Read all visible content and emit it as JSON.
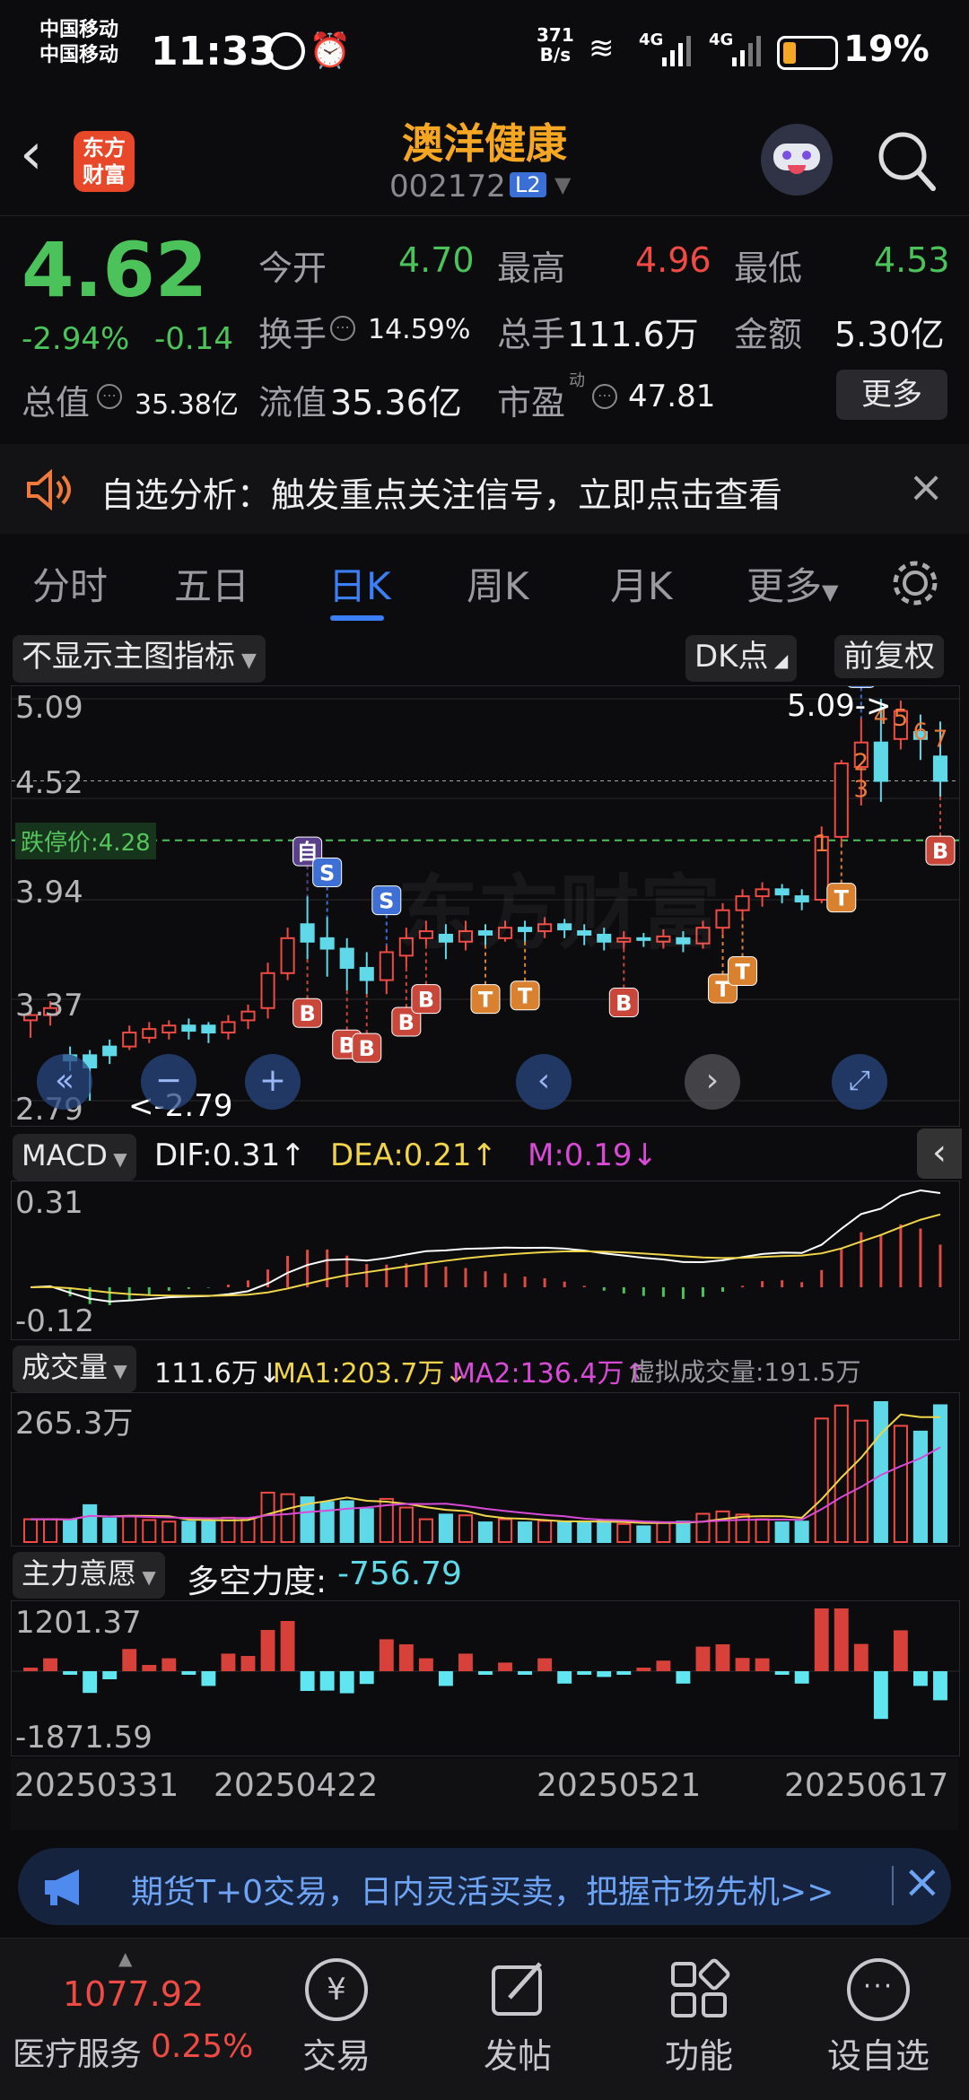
{
  "status": {
    "carrier1": "中国移动",
    "carrier2": "中国移动",
    "time": "11:33",
    "net_speed_top": "371",
    "net_speed_bottom": "B/s",
    "signal1": "4G",
    "signal2": "4G",
    "battery": "19%"
  },
  "header": {
    "logo_line1": "东方",
    "logo_line2": "财富",
    "stock_name": "澳洋健康",
    "stock_code": "002172",
    "level_badge": "L2"
  },
  "quote": {
    "price": "4.62",
    "change_pct": "-2.94%",
    "change": "-0.14",
    "open_label": "今开",
    "open": "4.70",
    "high_label": "最高",
    "high": "4.96",
    "low_label": "最低",
    "low": "4.53",
    "turnover_label": "换手",
    "turnover": "14.59%",
    "volume_label": "总手",
    "volume": "111.6万",
    "amount_label": "金额",
    "amount": "5.30亿",
    "mktcap_label": "总值",
    "mktcap": "35.38亿",
    "float_label": "流值",
    "float": "35.36亿",
    "pe_label": "市盈",
    "pe_sup": "动",
    "pe": "47.81",
    "more_btn": "更多"
  },
  "banner": {
    "text": "自选分析：触发重点关注信号，立即点击查看"
  },
  "tabs": [
    "分时",
    "五日",
    "日K",
    "周K",
    "月K",
    "更多"
  ],
  "active_tab": "日K",
  "chart_controls": {
    "indicator_dropdown": "不显示主图指标",
    "dk_button": "DK点",
    "fq_button": "前复权"
  },
  "chart_data": {
    "type": "candlestick",
    "price_axis": {
      "top": "5.09",
      "upper": "4.52",
      "mid": "3.94",
      "lower": "3.37",
      "bottom": "2.79"
    },
    "limit_down_label": "跌停价:4.28",
    "max_annotation": "5.09->",
    "min_annotation": "<-2.79",
    "dates": [
      "20250331",
      "20250422",
      "20250521",
      "20250617"
    ],
    "watermark": "东方财富",
    "candles": [
      [
        3.25,
        3.28,
        3.15,
        3.3
      ],
      [
        3.28,
        3.32,
        3.22,
        3.36
      ],
      [
        3.05,
        3.02,
        2.96,
        3.1
      ],
      [
        3.05,
        2.98,
        2.79,
        3.08
      ],
      [
        3.1,
        3.05,
        3.0,
        3.14
      ],
      [
        3.1,
        3.18,
        3.08,
        3.22
      ],
      [
        3.15,
        3.2,
        3.12,
        3.24
      ],
      [
        3.18,
        3.22,
        3.14,
        3.25
      ],
      [
        3.22,
        3.19,
        3.14,
        3.26
      ],
      [
        3.22,
        3.18,
        3.12,
        3.24
      ],
      [
        3.18,
        3.24,
        3.14,
        3.28
      ],
      [
        3.25,
        3.3,
        3.2,
        3.34
      ],
      [
        3.32,
        3.52,
        3.26,
        3.58
      ],
      [
        3.52,
        3.72,
        3.48,
        3.78
      ],
      [
        3.8,
        3.7,
        3.6,
        3.96
      ],
      [
        3.72,
        3.66,
        3.5,
        3.84
      ],
      [
        3.66,
        3.55,
        3.42,
        3.72
      ],
      [
        3.55,
        3.48,
        3.4,
        3.64
      ],
      [
        3.48,
        3.64,
        3.4,
        3.68
      ],
      [
        3.62,
        3.72,
        3.55,
        3.78
      ],
      [
        3.72,
        3.76,
        3.68,
        3.82
      ],
      [
        3.74,
        3.7,
        3.6,
        3.8
      ],
      [
        3.7,
        3.76,
        3.65,
        3.82
      ],
      [
        3.76,
        3.74,
        3.68,
        3.8
      ],
      [
        3.72,
        3.78,
        3.7,
        3.82
      ],
      [
        3.78,
        3.76,
        3.7,
        3.82
      ],
      [
        3.76,
        3.8,
        3.72,
        3.84
      ],
      [
        3.8,
        3.77,
        3.72,
        3.83
      ],
      [
        3.76,
        3.74,
        3.68,
        3.8
      ],
      [
        3.74,
        3.7,
        3.65,
        3.78
      ],
      [
        3.7,
        3.72,
        3.66,
        3.76
      ],
      [
        3.72,
        3.71,
        3.67,
        3.75
      ],
      [
        3.7,
        3.73,
        3.66,
        3.77
      ],
      [
        3.72,
        3.69,
        3.64,
        3.76
      ],
      [
        3.69,
        3.78,
        3.66,
        3.82
      ],
      [
        3.78,
        3.88,
        3.74,
        3.92
      ],
      [
        3.88,
        3.96,
        3.84,
        4.0
      ],
      [
        3.96,
        4.0,
        3.9,
        4.04
      ],
      [
        4.0,
        3.97,
        3.92,
        4.03
      ],
      [
        3.96,
        3.93,
        3.88,
        4.0
      ],
      [
        3.94,
        4.3,
        3.92,
        4.36
      ],
      [
        4.3,
        4.72,
        4.26,
        4.74
      ],
      [
        4.7,
        4.84,
        4.48,
        4.98
      ],
      [
        4.84,
        4.62,
        4.5,
        5.09
      ],
      [
        4.86,
        5.02,
        4.8,
        5.08
      ],
      [
        4.9,
        4.86,
        4.74,
        5.0
      ],
      [
        4.76,
        4.62,
        4.53,
        4.96
      ]
    ],
    "signals": [
      {
        "label": "自",
        "i": 14
      },
      {
        "label": "S",
        "i": 15
      },
      {
        "label": "S",
        "i": 18
      },
      {
        "label": "B",
        "i": 14
      },
      {
        "label": "B",
        "i": 16
      },
      {
        "label": "B",
        "i": 17
      },
      {
        "label": "B",
        "i": 19
      },
      {
        "label": "B",
        "i": 20
      },
      {
        "label": "B",
        "i": 30
      },
      {
        "label": "B",
        "i": 46
      },
      {
        "label": "T",
        "i": 23
      },
      {
        "label": "T",
        "i": 25
      },
      {
        "label": "T",
        "i": 35
      },
      {
        "label": "T",
        "i": 36
      },
      {
        "label": "T",
        "i": 41
      },
      {
        "label": "S",
        "i": 42
      },
      {
        "label": "1",
        "i": 40
      },
      {
        "label": "2",
        "i": 42
      },
      {
        "label": "3",
        "i": 42
      },
      {
        "label": "4",
        "i": 43
      },
      {
        "label": "5",
        "i": 44
      },
      {
        "label": "6",
        "i": 45
      },
      {
        "label": "7",
        "i": 46
      }
    ],
    "macd": {
      "label": "MACD",
      "dif": "DIF:0.31↑",
      "dea": "DEA:0.21↑",
      "m": "M:0.19↓",
      "axis_top": "0.31",
      "axis_bottom": "-0.12"
    },
    "volume": {
      "label": "成交量",
      "vol": "111.6万↓",
      "ma1": "MA1:203.7万↓",
      "ma2": "MA2:136.4万↑",
      "virtual": "虚拟成交量:191.5万",
      "axis_top": "265.3万"
    },
    "force": {
      "label": "主力意愿",
      "value_label": "多空力度:",
      "value": "-756.79",
      "axis_top": "1201.37",
      "axis_bottom": "-1871.59"
    }
  },
  "ad": {
    "text": "期货T+0交易，日内灵活买卖，把握市场先机>>"
  },
  "bottom_nav": {
    "index_value": "1077.92",
    "index_name": "医疗服务",
    "index_change": "0.25%",
    "items": [
      "交易",
      "发帖",
      "功能",
      "设自选"
    ]
  }
}
